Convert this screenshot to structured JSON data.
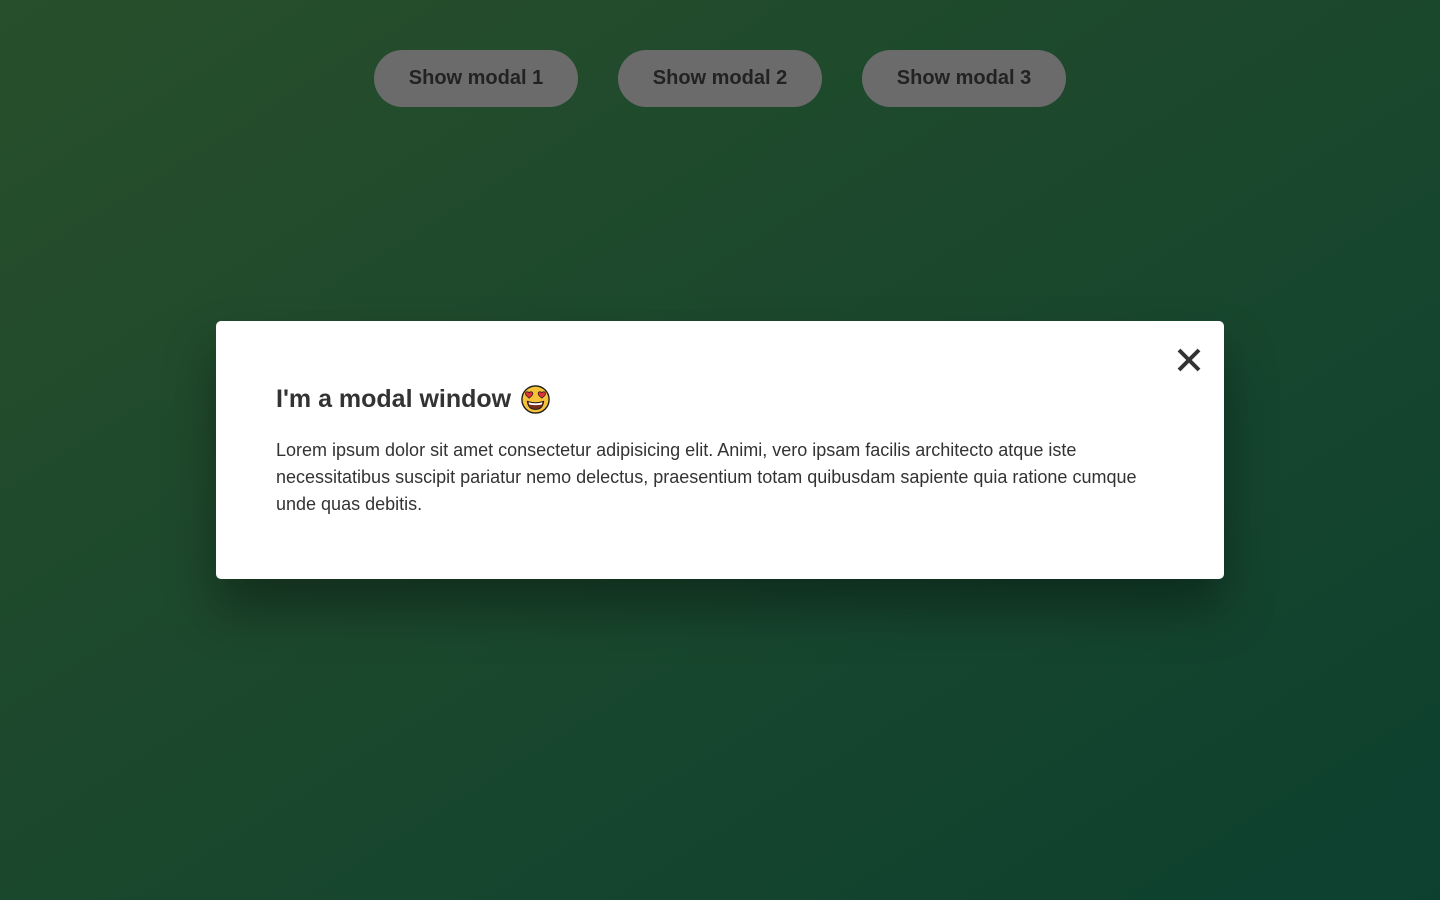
{
  "buttons": [
    {
      "label": "Show modal 1"
    },
    {
      "label": "Show modal 2"
    },
    {
      "label": "Show modal 3"
    }
  ],
  "modal": {
    "title": "I'm a modal window",
    "title_emoji_icon": "heart-eyes-emoji-icon",
    "close_icon": "close-icon",
    "body": "Lorem ipsum dolor sit amet consectetur adipisicing elit. Animi, vero ipsam facilis architecto atque iste necessitatibus suscipit pariatur nemo delectus, praesentium totam quibusdam sapiente quia ratione cumque unde quas debitis."
  },
  "colors": {
    "background_start": "#2e5a32",
    "background_end": "#0f4a36",
    "button_bg": "#6b6b6b",
    "modal_bg": "#ffffff",
    "text": "#333333"
  }
}
